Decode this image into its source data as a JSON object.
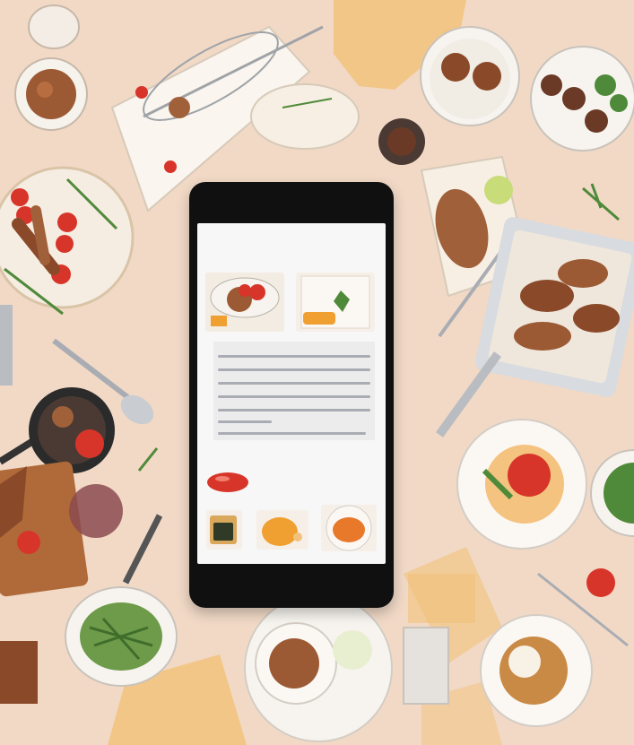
{
  "illustration": {
    "subject": "smartphone-recipe-app-among-food-dishes",
    "palette": {
      "background": "#f1d9c6",
      "phone_body": "#101010",
      "screen": "#f7f7f7",
      "text_lines": "#a9adb3",
      "sauce_orange": "#f0a030",
      "tomato_red": "#d8352a",
      "meat_brown": "#8a4a2a",
      "herb_green": "#4f8a3a",
      "cloth_yellow": "#f2c27a"
    }
  }
}
